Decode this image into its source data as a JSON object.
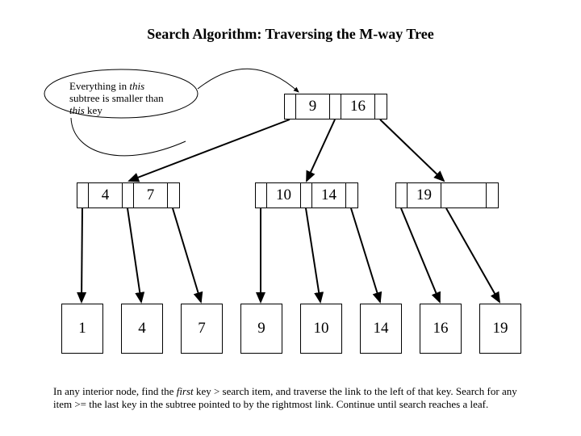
{
  "title": "Search Algorithm: Traversing the M-way Tree",
  "annotation": {
    "line1a": "Everything in ",
    "line1b": "this",
    "line2": "subtree is smaller than",
    "line3a": "this",
    "line3b": " key"
  },
  "root": {
    "k1": "9",
    "k2": "16"
  },
  "mid": {
    "left": {
      "k1": "4",
      "k2": "7"
    },
    "center": {
      "k1": "10",
      "k2": "14"
    },
    "right": {
      "k1": "19"
    }
  },
  "leaves": {
    "l0": "1",
    "l1": "4",
    "l2": "7",
    "l3": "9",
    "l4": "10",
    "l5": "14",
    "l6": "16",
    "l7": "19"
  },
  "footer": {
    "a": "In any interior node, find the ",
    "b": "first",
    "c": " key > search item, and traverse the link to the left of that key. Search for any item >= the last key in the subtree pointed to by the rightmost link. Continue until search reaches a leaf."
  }
}
